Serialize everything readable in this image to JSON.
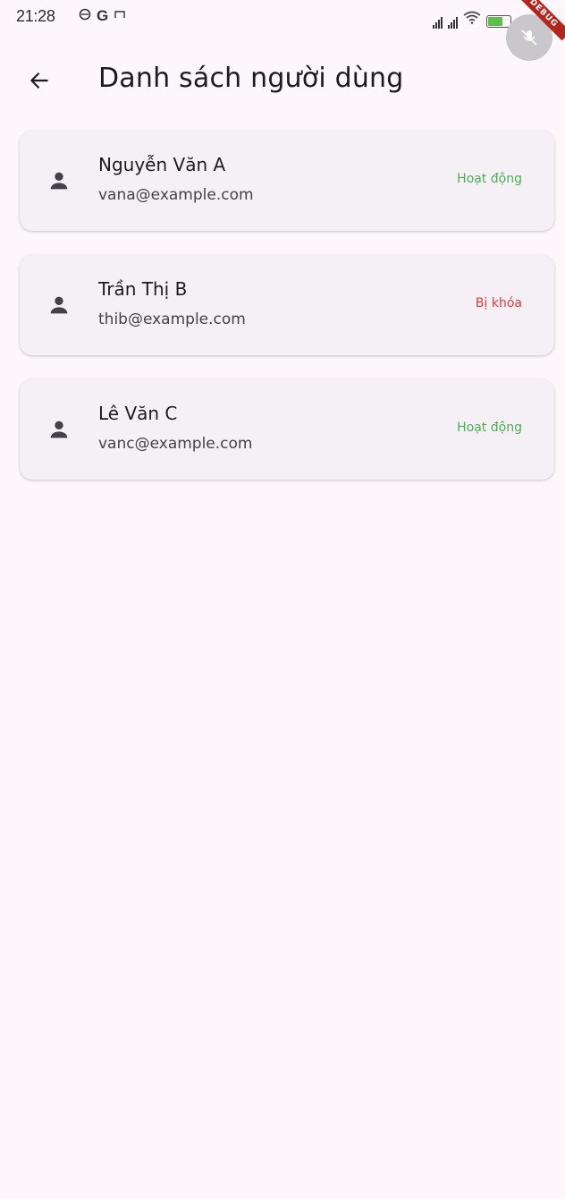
{
  "status_bar": {
    "time": "21:28",
    "left_icons": [
      "clock-icon",
      "google-icon",
      "cast-icon"
    ],
    "right_icons": [
      "signal-icon",
      "signal-icon",
      "wifi-icon",
      "battery-icon"
    ],
    "debug_banner": "DEBUG"
  },
  "app_bar": {
    "back_icon": "arrow-left-icon",
    "title": "Danh sách người dùng"
  },
  "colors": {
    "active": "#4caf50",
    "locked": "#e53935",
    "background": "#fdf7fb",
    "card": "#f5eff6"
  },
  "users": [
    {
      "name": "Nguyễn Văn A",
      "email": "vana@example.com",
      "status": "Hoạt động",
      "status_type": "active",
      "icon": "person-icon"
    },
    {
      "name": "Trần Thị B",
      "email": "thib@example.com",
      "status": "Bị khóa",
      "status_type": "locked",
      "icon": "person-icon"
    },
    {
      "name": "Lê Văn C",
      "email": "vanc@example.com",
      "status": "Hoạt động",
      "status_type": "active",
      "icon": "person-icon"
    }
  ]
}
